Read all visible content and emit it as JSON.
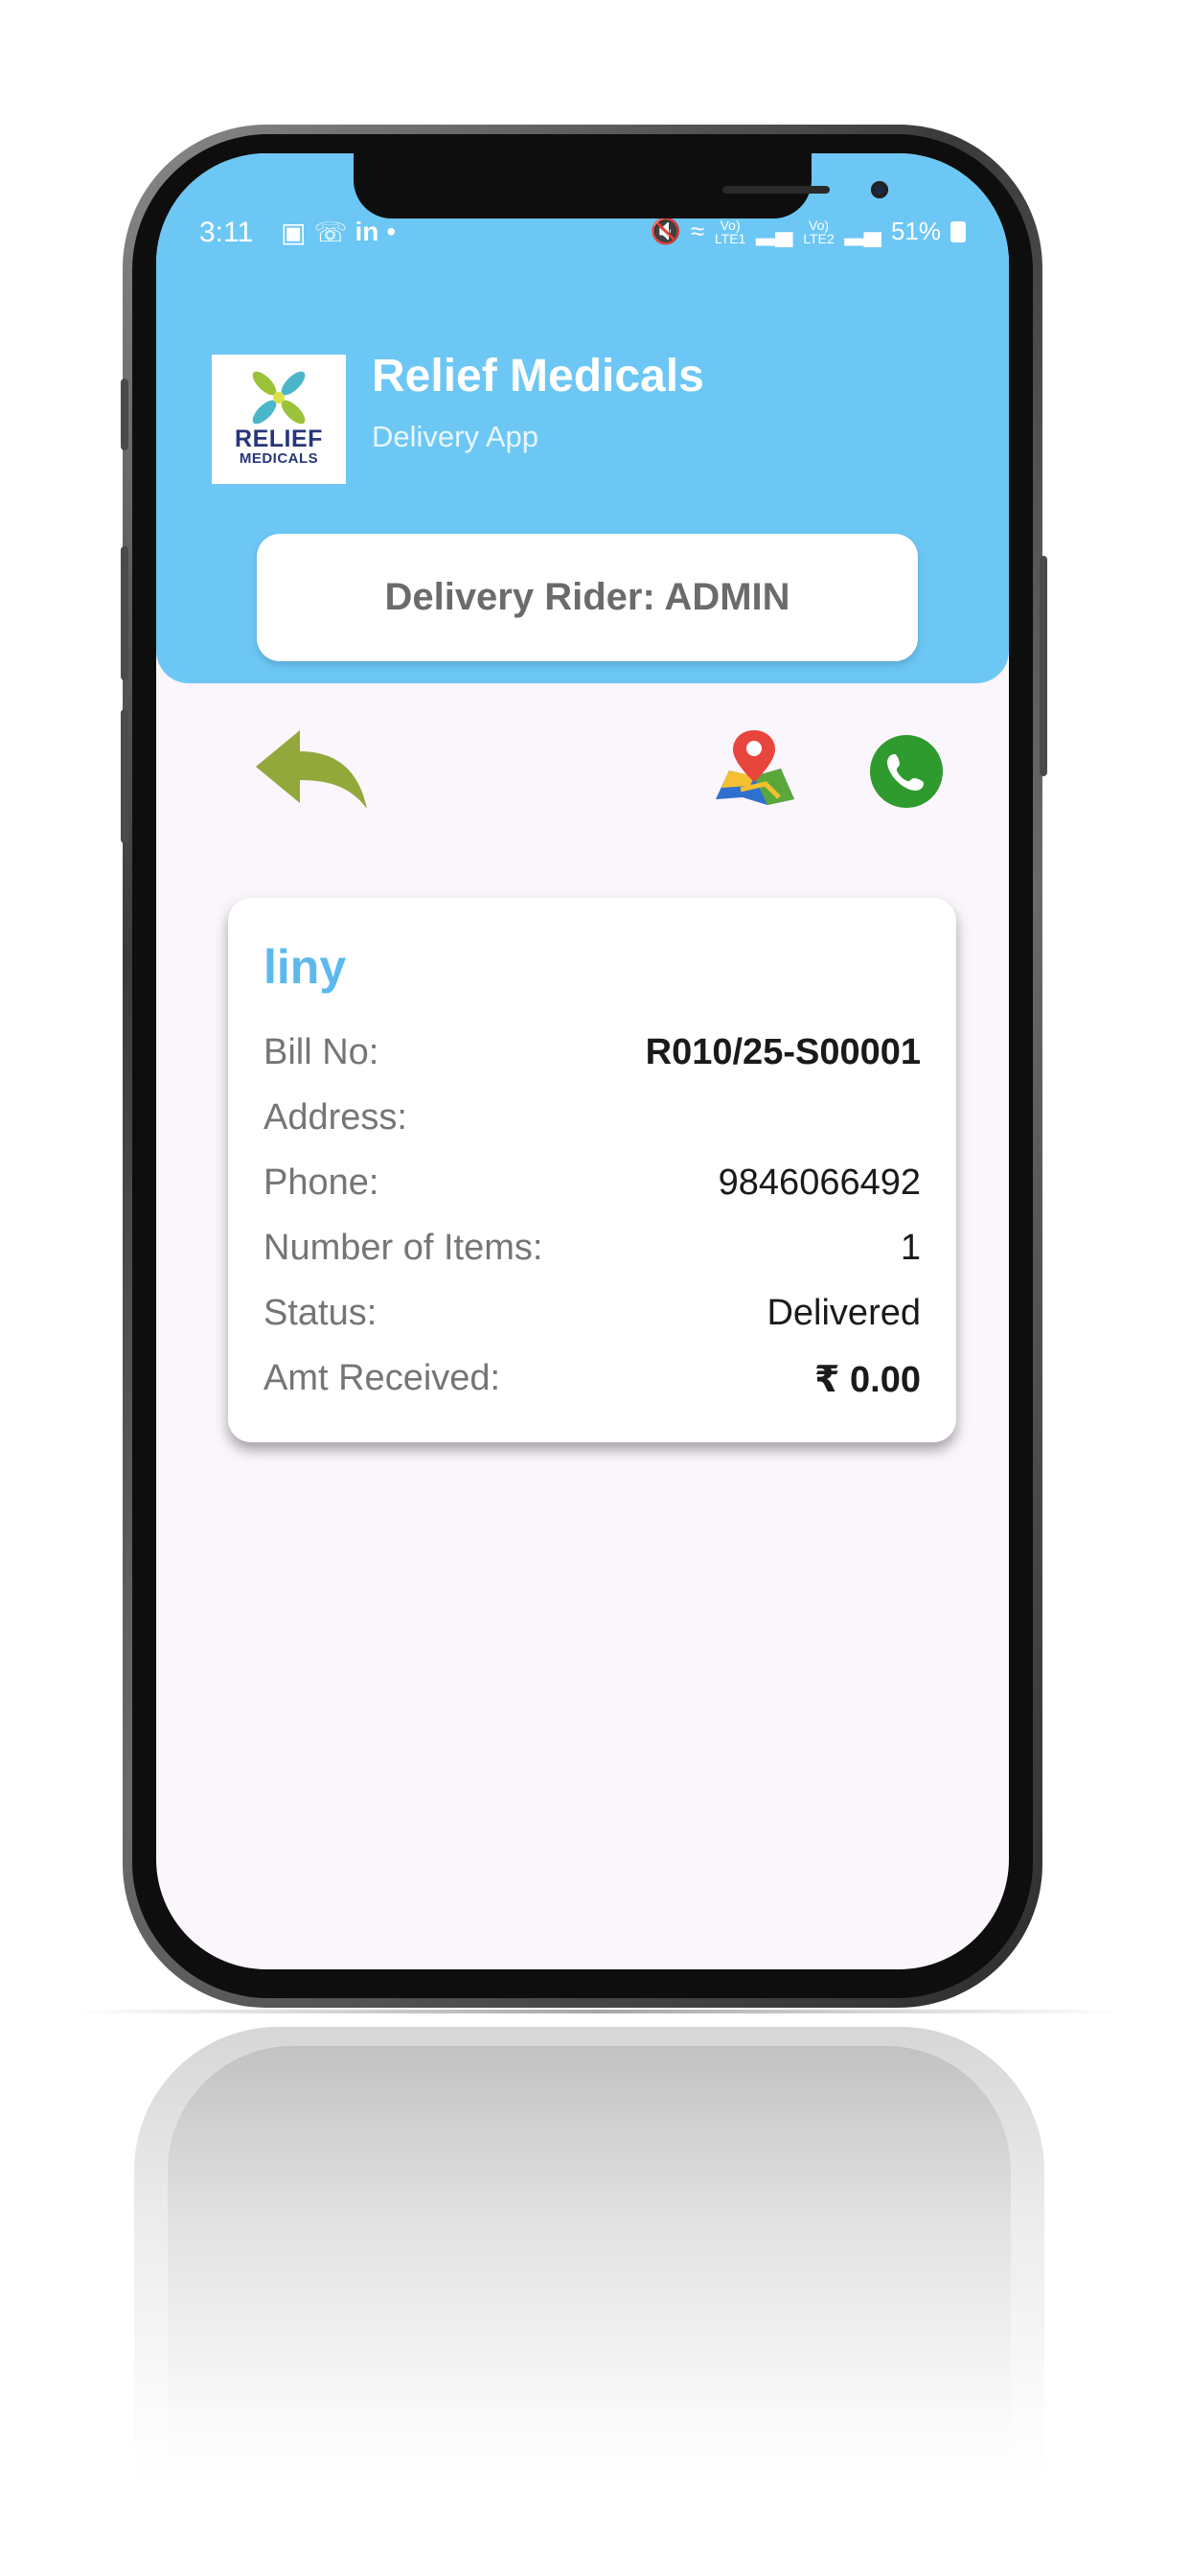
{
  "status_bar": {
    "time": "3:11",
    "battery": "51%",
    "sim1": "Vo) LTE1",
    "sim2": "Vo) LTE2"
  },
  "header": {
    "logo_line1": "RELIEF",
    "logo_line2": "MEDICALS",
    "title": "Relief Medicals",
    "subtitle": "Delivery App",
    "rider_label": "Delivery Rider: ADMIN"
  },
  "actions": {
    "back_icon": "reply-arrow-icon",
    "map_icon": "map-location-icon",
    "call_icon": "phone-icon"
  },
  "order": {
    "customer_name": "liny",
    "rows": [
      {
        "label": "Bill No:",
        "value": "R010/25-S00001",
        "bold": true
      },
      {
        "label": "Address:",
        "value": "",
        "bold": false
      },
      {
        "label": "Phone:",
        "value": "9846066492",
        "bold": false
      },
      {
        "label": "Number of Items:",
        "value": "1",
        "bold": false
      },
      {
        "label": "Status:",
        "value": "Delivered",
        "bold": false
      },
      {
        "label": "Amt Received:",
        "value": "₹ 0.00",
        "bold": true
      }
    ]
  },
  "colors": {
    "header": "#6cc7f5",
    "accent_name": "#5bb9ee",
    "back_arrow": "#93a83a",
    "call": "#2f9a2e",
    "screen_bg": "#fbf5fc"
  }
}
